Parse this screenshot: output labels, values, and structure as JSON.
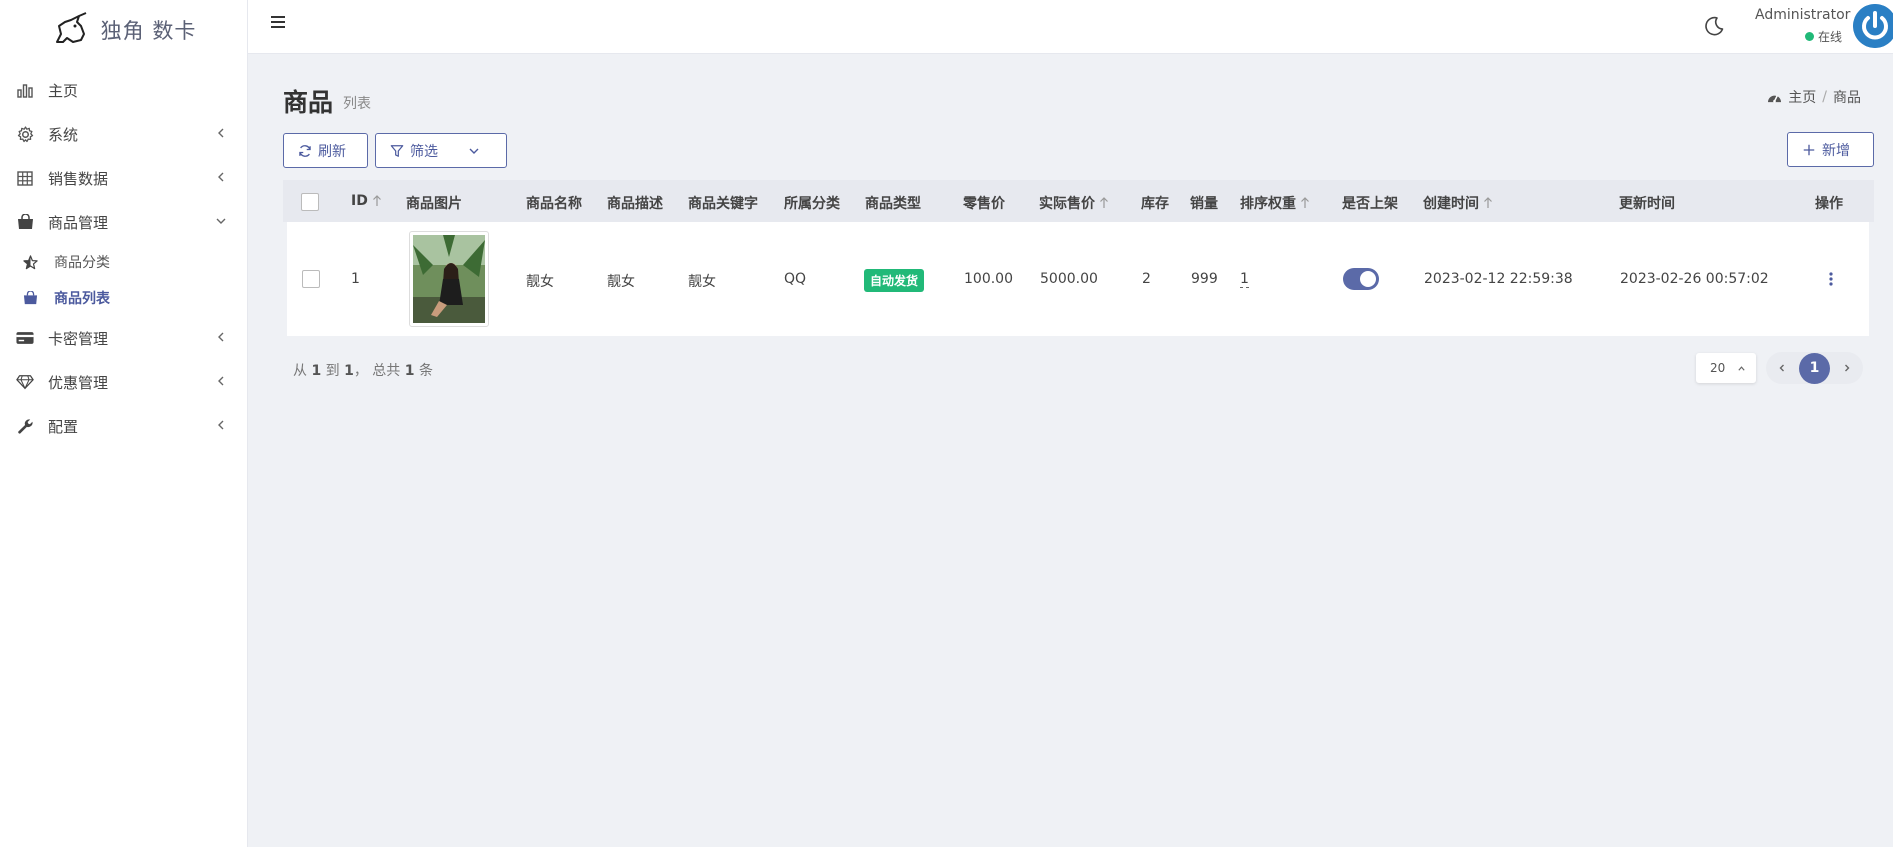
{
  "brand": {
    "name": "独角 数卡"
  },
  "sidebar": {
    "items": [
      {
        "label": "主页",
        "icon": "bar-chart-icon"
      },
      {
        "label": "系统",
        "icon": "gear-icon"
      },
      {
        "label": "销售数据",
        "icon": "table-icon"
      },
      {
        "label": "商品管理",
        "icon": "shopping-bag-icon"
      },
      {
        "label": "卡密管理",
        "icon": "credit-card-icon"
      },
      {
        "label": "优惠管理",
        "icon": "diamond-icon"
      },
      {
        "label": "配置",
        "icon": "wrench-icon"
      }
    ],
    "subitems": [
      {
        "label": "商品分类",
        "icon": "star-icon"
      },
      {
        "label": "商品列表",
        "icon": "shopping-bag-icon"
      }
    ]
  },
  "header": {
    "user_name": "Administrator",
    "user_status": "在线"
  },
  "page": {
    "title": "商品",
    "subtitle": "列表"
  },
  "breadcrumb": {
    "home": "主页",
    "current": "商品"
  },
  "toolbar": {
    "refresh_label": "刷新",
    "filter_label": "筛选",
    "add_label": "新增"
  },
  "table": {
    "columns": [
      "ID",
      "商品图片",
      "商品名称",
      "商品描述",
      "商品关键字",
      "所属分类",
      "商品类型",
      "零售价",
      "实际售价",
      "库存",
      "销量",
      "排序权重",
      "是否上架",
      "创建时间",
      "更新时间",
      "操作"
    ],
    "rows": [
      {
        "id": "1",
        "name": "靓女",
        "description": "靓女",
        "keywords": "靓女",
        "category": "QQ",
        "type": "自动发货",
        "retail_price": "100.00",
        "actual_price": "5000.00",
        "stock": "2",
        "sales": "999",
        "sort_weight": "1",
        "on_sale": true,
        "created_at": "2023-02-12 22:59:38",
        "updated_at": "2023-02-26 00:57:02"
      }
    ]
  },
  "summary": {
    "from_label": "从",
    "from": "1",
    "to_label": "到",
    "to": "1",
    "total_label": "， 总共",
    "total": "1",
    "unit": "条"
  },
  "pagination": {
    "per_page": "20",
    "current_page": "1"
  },
  "colors": {
    "accent": "#5b6aa8",
    "success": "#21b978",
    "avatar": "#2a7fc4"
  }
}
